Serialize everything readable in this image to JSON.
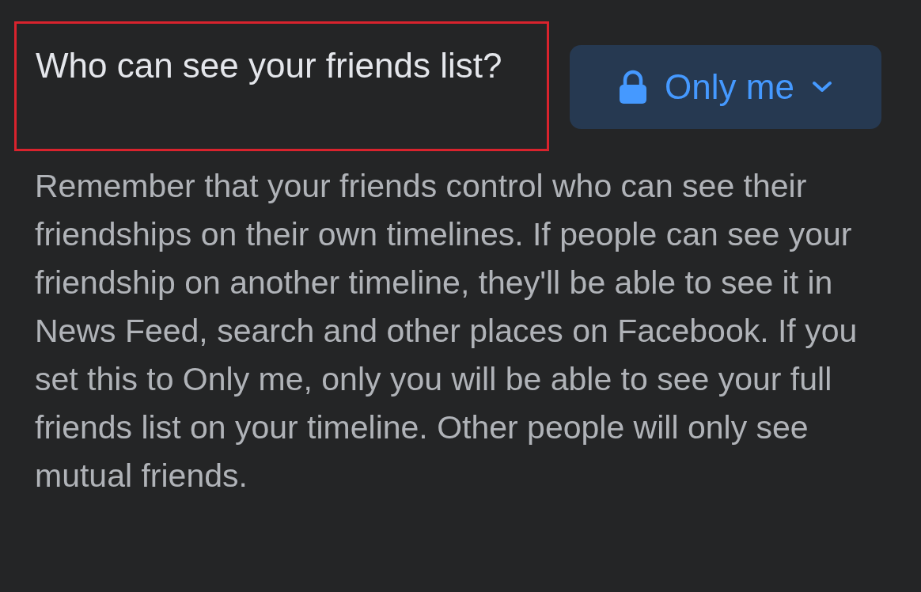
{
  "setting": {
    "question": "Who can see your friends list?",
    "highlighted": true,
    "audience_button": {
      "label": "Only me"
    },
    "description": "Remember that your friends control who can see their friendships on their own timelines. If people can see your friendship on another timeline, they'll be able to see it in News Feed, search and other places on Facebook. If you set this to Only me, only you will be able to see your full friends list on your timeline. Other people will only see mutual friends."
  }
}
